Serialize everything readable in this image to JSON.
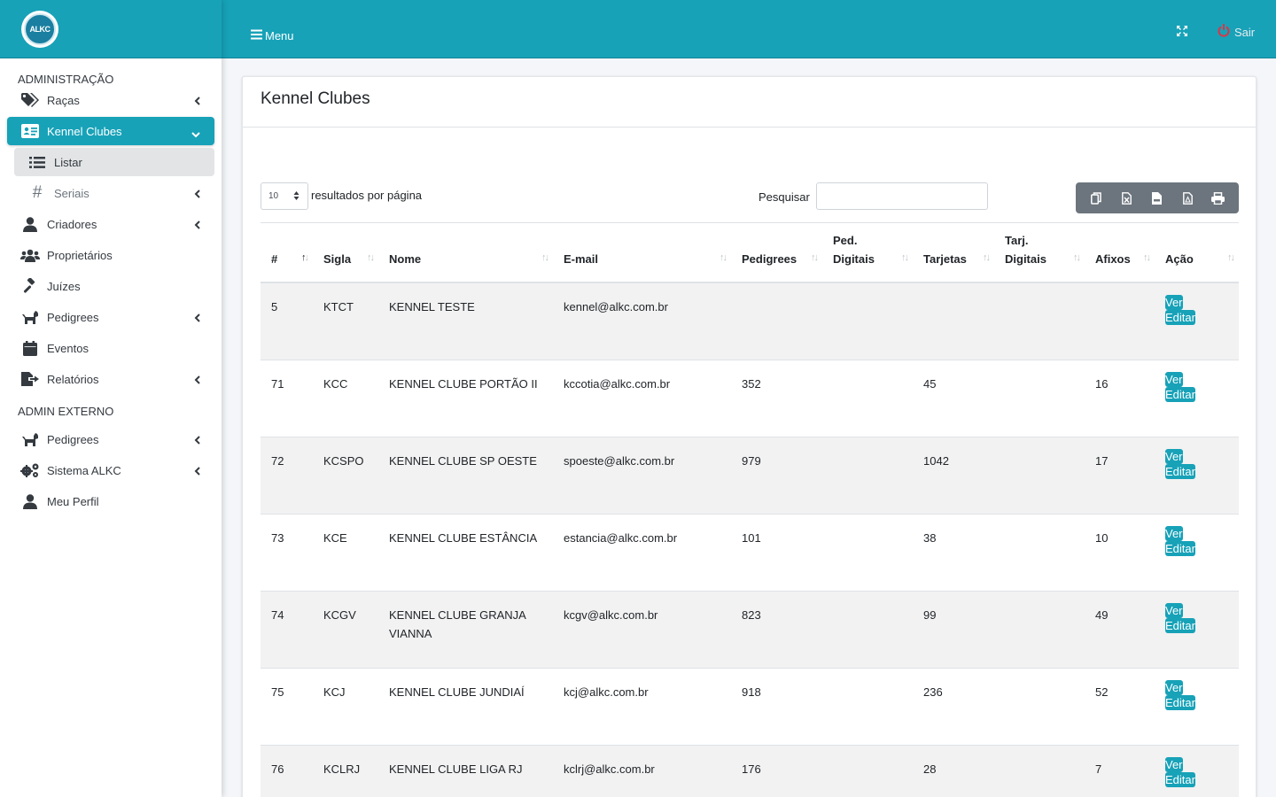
{
  "brand": {
    "logo_text": "ALKC"
  },
  "sidebar": {
    "section1": "ADMINISTRAÇÃO",
    "items": [
      {
        "label": "Raças"
      },
      {
        "label": "Kennel Clubes"
      },
      {
        "label": "Listar"
      },
      {
        "label": "Seriais"
      },
      {
        "label": "Criadores"
      },
      {
        "label": "Proprietários"
      },
      {
        "label": "Juízes"
      },
      {
        "label": "Pedigrees"
      },
      {
        "label": "Eventos"
      },
      {
        "label": "Relatórios"
      }
    ],
    "section2": "ADMIN EXTERNO",
    "items2": [
      {
        "label": "Pedigrees"
      },
      {
        "label": "Sistema ALKC"
      },
      {
        "label": "Meu Perfil"
      }
    ]
  },
  "topbar": {
    "menu_label": "Menu",
    "logout_label": "Sair"
  },
  "card": {
    "title": "Kennel Clubes"
  },
  "controls": {
    "page_length": "10",
    "page_length_label": "resultados por página",
    "search_label": "Pesquisar",
    "search_value": ""
  },
  "table": {
    "headers": [
      "#",
      "Sigla",
      "Nome",
      "E-mail",
      "Pedigrees",
      "Ped. Digitais",
      "Tarjetas",
      "Tarj. Digitais",
      "Afixos",
      "Ação"
    ],
    "view_label": "Ver",
    "edit_label": "Editar",
    "rows": [
      {
        "id": "5",
        "sigla": "KTCT",
        "nome": "KENNEL TESTE",
        "email": "kennel@alkc.com.br",
        "pedigrees": "",
        "ped_digitais": "",
        "tarjetas": "",
        "tarj_digitais": "",
        "afixos": ""
      },
      {
        "id": "71",
        "sigla": "KCC",
        "nome": "KENNEL CLUBE PORTÃO II",
        "email": "kccotia@alkc.com.br",
        "pedigrees": "352",
        "ped_digitais": "",
        "tarjetas": "45",
        "tarj_digitais": "",
        "afixos": "16"
      },
      {
        "id": "72",
        "sigla": "KCSPO",
        "nome": "KENNEL CLUBE SP OESTE",
        "email": "spoeste@alkc.com.br",
        "pedigrees": "979",
        "ped_digitais": "",
        "tarjetas": "1042",
        "tarj_digitais": "",
        "afixos": "17"
      },
      {
        "id": "73",
        "sigla": "KCE",
        "nome": "KENNEL CLUBE ESTÂNCIA",
        "email": "estancia@alkc.com.br",
        "pedigrees": "101",
        "ped_digitais": "",
        "tarjetas": "38",
        "tarj_digitais": "",
        "afixos": "10"
      },
      {
        "id": "74",
        "sigla": "KCGV",
        "nome": "KENNEL CLUBE GRANJA VIANNA",
        "email": "kcgv@alkc.com.br",
        "pedigrees": "823",
        "ped_digitais": "",
        "tarjetas": "99",
        "tarj_digitais": "",
        "afixos": "49"
      },
      {
        "id": "75",
        "sigla": "KCJ",
        "nome": "KENNEL CLUBE JUNDIAÍ",
        "email": "kcj@alkc.com.br",
        "pedigrees": "918",
        "ped_digitais": "",
        "tarjetas": "236",
        "tarj_digitais": "",
        "afixos": "52"
      },
      {
        "id": "76",
        "sigla": "KCLRJ",
        "nome": "KENNEL CLUBE LIGA RJ",
        "email": "kclrj@alkc.com.br",
        "pedigrees": "176",
        "ped_digitais": "",
        "tarjetas": "28",
        "tarj_digitais": "",
        "afixos": "7"
      }
    ]
  },
  "icons": {
    "sidebar": [
      "tags-icon",
      "id-card-icon",
      "list-icon",
      "hashtag-icon",
      "user-icon",
      "users-icon",
      "gavel-icon",
      "dog-icon",
      "calendar-icon",
      "file-export-icon",
      "dog-icon",
      "gears-icon",
      "user-icon"
    ],
    "export": [
      "copy-icon",
      "excel-icon",
      "csv-icon",
      "pdf-icon",
      "print-icon"
    ]
  },
  "colors": {
    "primary": "#17a2b8",
    "toolbar": "#6c757d"
  }
}
